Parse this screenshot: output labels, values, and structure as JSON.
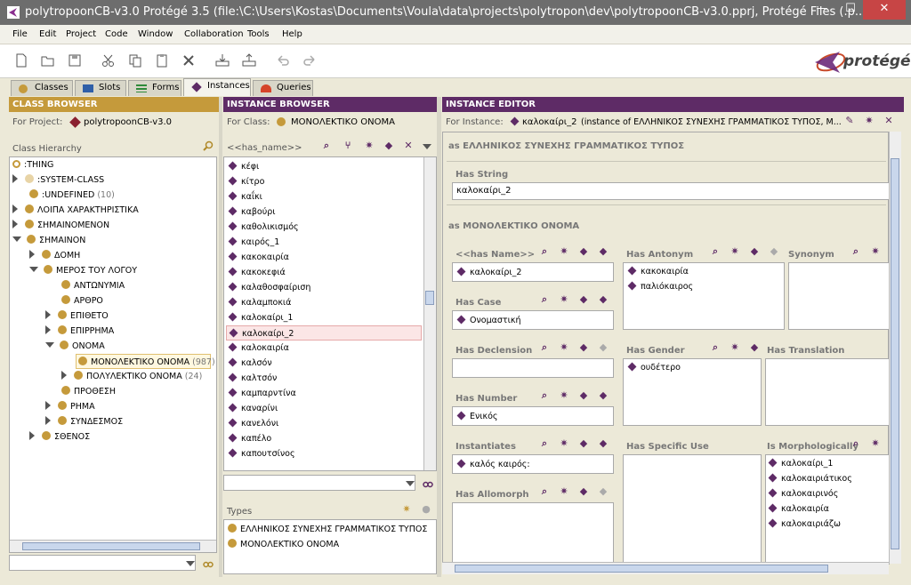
{
  "window": {
    "title": "polytropoonCB-v3.0  Protégé 3.5      (file:\\C:\\Users\\Kostas\\Documents\\Voula\\data\\projects\\polytropon\\dev\\polytropoonCB-v3.0.pprj, Protégé Files (.p...",
    "min": "—",
    "max": "☐",
    "close": "✕"
  },
  "menu": [
    "File",
    "Edit",
    "Project",
    "Code",
    "Window",
    "Collaboration",
    "Tools",
    "Help"
  ],
  "logo": "protégé",
  "tabs": [
    "Classes",
    "Slots",
    "Forms",
    "Instances",
    "Queries"
  ],
  "class_browser": {
    "header": "CLASS BROWSER",
    "for_project_label": "For Project:",
    "project": "polytropoonCB-v3.0",
    "hierarchy_label": "Class Hierarchy",
    "tree": [
      {
        "label": ":THING",
        "count": ""
      },
      {
        "label": ":SYSTEM-CLASS",
        "count": ""
      },
      {
        "label": ":UNDEFINED",
        "count": "(10)"
      },
      {
        "label": "ΛΟΙΠΑ ΧΑΡΑΚΤΗΡΙΣΤΙΚΑ",
        "count": ""
      },
      {
        "label": "ΣΗΜΑΙΝΟΜΕΝΟΝ",
        "count": ""
      },
      {
        "label": "ΣΗΜΑΙΝΟΝ",
        "count": ""
      },
      {
        "label": "ΔΟΜΗ",
        "count": ""
      },
      {
        "label": "ΜΕΡΟΣ ΤΟΥ ΛΟΓΟΥ",
        "count": ""
      },
      {
        "label": "ΑΝΤΩΝΥΜΙΑ",
        "count": ""
      },
      {
        "label": "ΑΡΘΡΟ",
        "count": ""
      },
      {
        "label": "ΕΠΙΘΕΤΟ",
        "count": ""
      },
      {
        "label": "ΕΠΙΡΡΗΜΑ",
        "count": ""
      },
      {
        "label": "ΟΝΟΜΑ",
        "count": ""
      },
      {
        "label": "ΜΟΝΟΛΕΚΤΙΚΟ ΟΝΟΜΑ",
        "count": "(987)"
      },
      {
        "label": "ΠΟΛΥΛΕΚΤΙΚΟ ΟΝΟΜΑ",
        "count": "(24)"
      },
      {
        "label": "ΠΡΟΘΕΣΗ",
        "count": ""
      },
      {
        "label": "ΡΗΜΑ",
        "count": ""
      },
      {
        "label": "ΣΥΝΔΕΣΜΟΣ",
        "count": ""
      },
      {
        "label": "ΣΘΕΝΟΣ",
        "count": ""
      }
    ]
  },
  "instance_browser": {
    "header": "INSTANCE BROWSER",
    "for_class_label": "For Class:",
    "class": "ΜΟΝΟΛΕΚΤΙΚΟ ΟΝΟΜΑ",
    "slot": "<<has_name>>",
    "instances": [
      "κέφι",
      "κίτρο",
      "καΐκι",
      "καβούρι",
      "καθολικισμός",
      "καιρός_1",
      "κακοκαιρία",
      "κακοκεφιά",
      "καλαθοσφαίριση",
      "καλαμποκιά",
      "καλοκαίρι_1",
      "καλοκαίρι_2",
      "καλοκαιρία",
      "καλσόν",
      "καλτσόν",
      "καμπαρντίνα",
      "καναρίνι",
      "κανελόνι",
      "καπέλο",
      "καπουτσίνος"
    ],
    "types_label": "Types",
    "types": [
      "ΕΛΛΗΝΙΚΟΣ ΣΥΝΕΧΗΣ ΓΡΑΜΜΑΤΙΚΟΣ ΤΥΠΟΣ",
      "ΜΟΝΟΛΕΚΤΙΚΟ ΟΝΟΜΑ"
    ]
  },
  "instance_editor": {
    "header": "INSTANCE EDITOR",
    "for_instance_label": "For Instance:",
    "instance": "καλοκαίρι_2",
    "instance_of": "(instance of ΕΛΛΗΝΙΚΟΣ ΣΥΝΕΧΗΣ ΓΡΑΜΜΑΤΙΚΟΣ ΤΥΠΟΣ, Μ...",
    "section1": "as ΕΛΛΗΝΙΚΟΣ ΣΥΝΕΧΗΣ ΓΡΑΜΜΑΤΙΚΟΣ ΤΥΠΟΣ",
    "has_string_label": "Has String",
    "has_string": "καλοκαίρι_2",
    "section2": "as ΜΟΝΟΛΕΚΤΙΚΟ ΟΝΟΜΑ",
    "has_name_label": "<<has Name>>",
    "has_name": "καλοκαίρι_2",
    "has_antonym_label": "Has Antonym",
    "has_antonym": [
      "κακοκαιρία",
      "παλιόκαιρος"
    ],
    "synonym_label": "Synonym",
    "has_case_label": "Has Case",
    "has_case": "Ονομαστική",
    "has_declension_label": "Has Declension",
    "has_gender_label": "Has Gender",
    "has_gender": "ουδέτερο",
    "has_translation_label": "Has Translation",
    "has_number_label": "Has Number",
    "has_number": "Ενικός",
    "instantiates_label": "Instantiates",
    "instantiates": "καλός καιρός:",
    "has_specific_use_label": "Has Specific Use",
    "is_morph_label": "Is Morphologically",
    "is_morph": [
      "καλοκαίρι_1",
      "καλοκαιριάτικος",
      "καλοκαιρινός",
      "καλοκαιρία",
      "καλοκαιριάζω"
    ],
    "has_allomorph_label": "Has Allomorph"
  }
}
